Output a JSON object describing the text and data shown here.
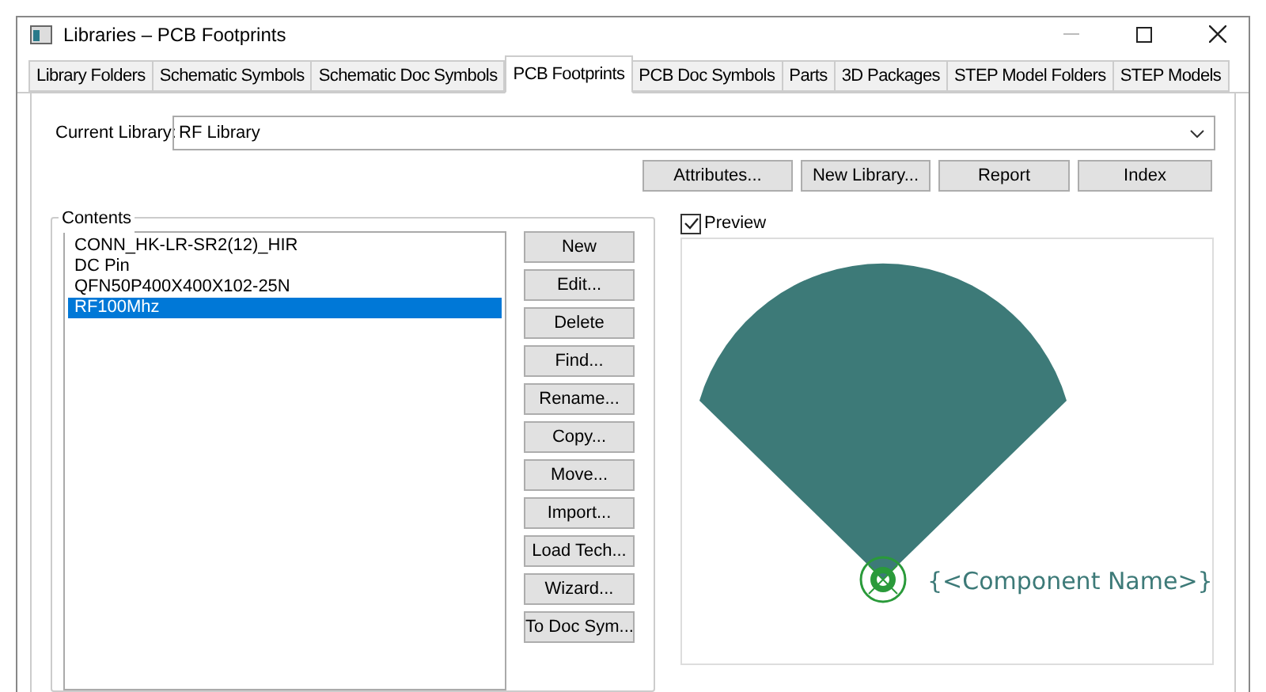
{
  "window": {
    "title": "Libraries – PCB Footprints"
  },
  "tabs": [
    {
      "label": "Library Folders",
      "selected": false
    },
    {
      "label": "Schematic Symbols",
      "selected": false
    },
    {
      "label": "Schematic Doc Symbols",
      "selected": false
    },
    {
      "label": "PCB Footprints",
      "selected": true
    },
    {
      "label": "PCB Doc Symbols",
      "selected": false
    },
    {
      "label": "Parts",
      "selected": false
    },
    {
      "label": "3D Packages",
      "selected": false
    },
    {
      "label": "STEP Model Folders",
      "selected": false
    },
    {
      "label": "STEP Models",
      "selected": false
    }
  ],
  "current_library": {
    "label": "Current Library:",
    "value": "RF Library"
  },
  "library_buttons": [
    "Attributes...",
    "New Library...",
    "Report",
    "Index"
  ],
  "contents": {
    "title": "Contents",
    "items": [
      {
        "label": "CONN_HK-LR-SR2(12)_HIR",
        "selected": false
      },
      {
        "label": "DC Pin",
        "selected": false
      },
      {
        "label": "QFN50P400X400X102-25N",
        "selected": false
      },
      {
        "label": "RF100Mhz",
        "selected": true
      }
    ]
  },
  "content_buttons": [
    "New",
    "Edit...",
    "Delete",
    "Find...",
    "Rename...",
    "Copy...",
    "Move...",
    "Import...",
    "Load Tech...",
    "Wizard...",
    "To Doc Sym..."
  ],
  "preview": {
    "label": "Preview",
    "checked": true,
    "designator": "{<Component Name>}"
  }
}
